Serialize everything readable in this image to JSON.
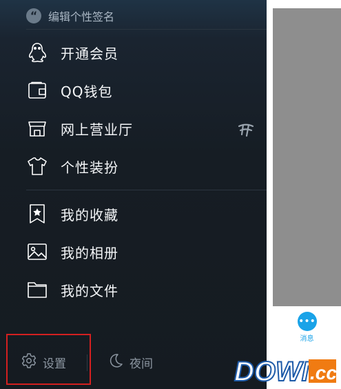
{
  "signature": {
    "placeholder": "编辑个性签名",
    "quote_glyph": "“"
  },
  "menu": {
    "group1": [
      {
        "label": "开通会员",
        "icon": "penguin-icon"
      },
      {
        "label": "QQ钱包",
        "icon": "wallet-icon"
      },
      {
        "label": "网上营业厅",
        "icon": "store-icon"
      },
      {
        "label": "个性装扮",
        "icon": "tshirt-icon"
      }
    ],
    "group2": [
      {
        "label": "我的收藏",
        "icon": "bookmark-star-icon"
      },
      {
        "label": "我的相册",
        "icon": "picture-icon"
      },
      {
        "label": "我的文件",
        "icon": "folder-icon"
      }
    ]
  },
  "bottom": {
    "settings_label": "设置",
    "night_label": "夜间"
  },
  "background": {
    "messages_label": "消息"
  },
  "watermark": {
    "text_main": "DOWN",
    "text_tld": ".cc"
  },
  "colors": {
    "highlight_border": "#d42020",
    "accent": "#1aa3e8",
    "drawer_bg": "#161d24"
  }
}
